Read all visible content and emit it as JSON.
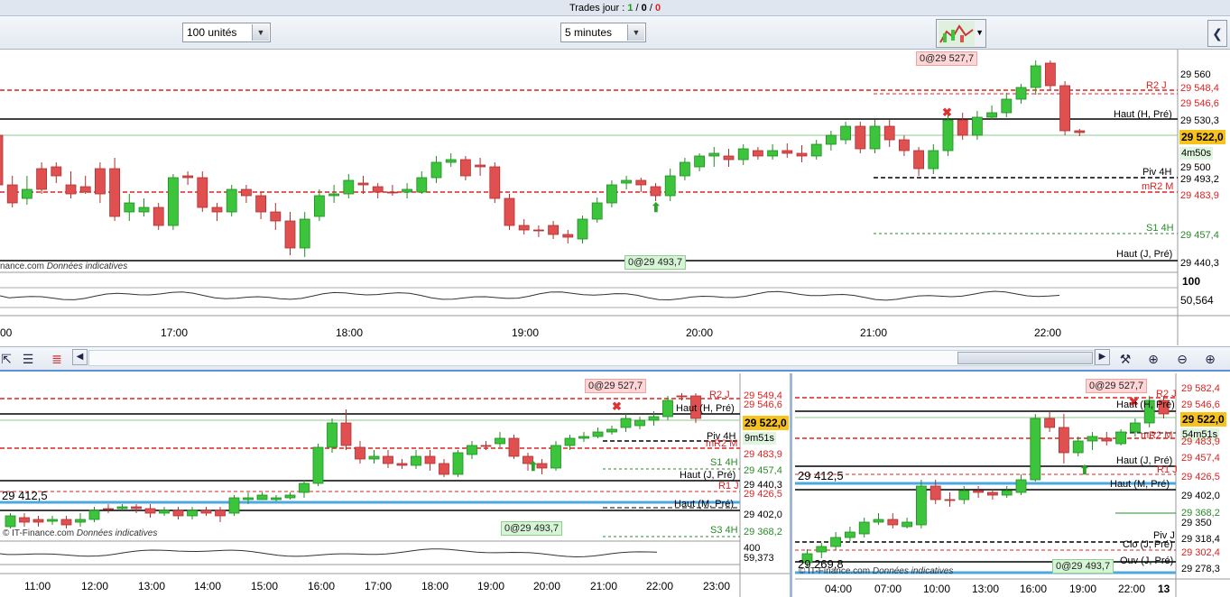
{
  "titlebar": {
    "label": "Trades jour : ",
    "wins": "1",
    "sep1": " / ",
    "neutral": "0",
    "sep2": " / ",
    "losses": "0"
  },
  "toolbar": {
    "units_value": "100 unités",
    "timeframe_value": "5 minutes"
  },
  "top_chart": {
    "price_labels": [
      {
        "text": "29 560",
        "color": "#000"
      },
      {
        "text": "29 548,4",
        "color": "#d22"
      },
      {
        "text": "29 546,6",
        "color": "#d22"
      },
      {
        "text": "29 530,3",
        "color": "#000"
      },
      {
        "text": "29 522,0",
        "color": "#000"
      },
      {
        "text": "4m50s",
        "color": "#000"
      },
      {
        "text": "29 500",
        "color": "#000"
      },
      {
        "text": "29 493,2",
        "color": "#000"
      },
      {
        "text": "29 483,9",
        "color": "#d22"
      },
      {
        "text": "29 457,4",
        "color": "#2a8a2a"
      },
      {
        "text": "29 440,3",
        "color": "#000"
      }
    ],
    "level_names": {
      "r2j": "R2 J",
      "haut_h": "Haut (H, Pré)",
      "piv4h": "Piv 4H",
      "mr2m": "mR2 M",
      "s14h": "S1 4H",
      "haut_j": "Haut (J, Pré)"
    },
    "order_sell": "0@29 527,7",
    "order_buy": "0@29 493,7",
    "watermark_prefix": "nance.com",
    "watermark_note": "Données indicatives",
    "osc_labels": [
      "100",
      "50,564"
    ],
    "time_ticks": [
      "00",
      "17:00",
      "18:00",
      "19:00",
      "20:00",
      "21:00",
      "22:00"
    ]
  },
  "bottom_left": {
    "price_labels": [
      {
        "text": "29 549,4",
        "color": "#d22"
      },
      {
        "text": "29 546,6",
        "color": "#d22"
      },
      {
        "text": "29 522,0",
        "color": "#000"
      },
      {
        "text": "9m51s",
        "color": "#000"
      },
      {
        "text": "29 483,9",
        "color": "#d22"
      },
      {
        "text": "29 457,4",
        "color": "#2a8a2a"
      },
      {
        "text": "29 440,3",
        "color": "#000"
      },
      {
        "text": "29 426,5",
        "color": "#d22"
      },
      {
        "text": "29 402,0",
        "color": "#000"
      },
      {
        "text": "29 368,2",
        "color": "#2a8a2a"
      },
      {
        "text": "400",
        "color": "#000"
      },
      {
        "text": "59,373",
        "color": "#000"
      }
    ],
    "level_names": {
      "r2j": "R2 J",
      "haut_h": "Haut (H, Pré)",
      "piv4h": "Piv 4H",
      "mr2m": "mR2 M",
      "s14h": "S1 4H",
      "haut_j": "Haut (J, Pré)",
      "r1j": "R1 J",
      "haut_m": "Haut (M, Pré)",
      "s34h": "S3 4H"
    },
    "left_price": "29 412,5",
    "order_sell": "0@29 527,7",
    "order_buy": "0@29 493,7",
    "watermark_prefix": "© IT-Finance.com",
    "watermark_note": "Données indicatives",
    "time_ticks": [
      "11:00",
      "12:00",
      "13:00",
      "14:00",
      "15:00",
      "16:00",
      "17:00",
      "18:00",
      "19:00",
      "20:00",
      "21:00",
      "22:00",
      "23:00"
    ]
  },
  "bottom_right": {
    "price_labels": [
      {
        "text": "29 582,4",
        "color": "#d22"
      },
      {
        "text": "29 546,6",
        "color": "#d22"
      },
      {
        "text": "29 522,0",
        "color": "#000"
      },
      {
        "text": "54m51s",
        "color": "#000"
      },
      {
        "text": "29 483,9",
        "color": "#d22"
      },
      {
        "text": "29 457,4",
        "color": "#d22"
      },
      {
        "text": "29 426,5",
        "color": "#d22"
      },
      {
        "text": "29 402,0",
        "color": "#000"
      },
      {
        "text": "29 368,2",
        "color": "#2a8a2a"
      },
      {
        "text": "29 350",
        "color": "#000"
      },
      {
        "text": "29 318,4",
        "color": "#000"
      },
      {
        "text": "29 302,4",
        "color": "#d22"
      },
      {
        "text": "29 278,3",
        "color": "#000"
      }
    ],
    "level_names": {
      "r2j": "R2 J",
      "haut_h": "Haut (H, Pré)",
      "mr2m": "mR2 M",
      "haut_j": "Haut (J, Pré)",
      "r1j": "R1 J",
      "haut_m": "Haut (M, Pré)",
      "pivj": "Piv J",
      "clo": "Clo (J, Pré)",
      "ouv": "Ouv (J, Pré)"
    },
    "left_price": "29 412,5",
    "low_price": "29 269,8",
    "order_sell": "0@29 527,7",
    "order_buy": "0@29 493,7",
    "watermark_prefix": "© IT-Finance.com",
    "watermark_note": "Données indicatives",
    "time_ticks": [
      "04:00",
      "07:00",
      "10:00",
      "13:00",
      "16:00",
      "19:00",
      "22:00",
      "13"
    ]
  },
  "colors": {
    "up": "#3cc43c",
    "down": "#e05050",
    "resistance": "#d22",
    "support": "#2a8a2a",
    "current": "#f7c21b"
  },
  "icons": [
    "indicators-icon",
    "zoom-fit-icon",
    "zoom-out-icon",
    "zoom-in-icon",
    "pointer-icon",
    "properties-icon",
    "layers-icon",
    "scroll-left-icon",
    "scroll-right-icon",
    "chart-style-icon",
    "collapse-icon"
  ]
}
